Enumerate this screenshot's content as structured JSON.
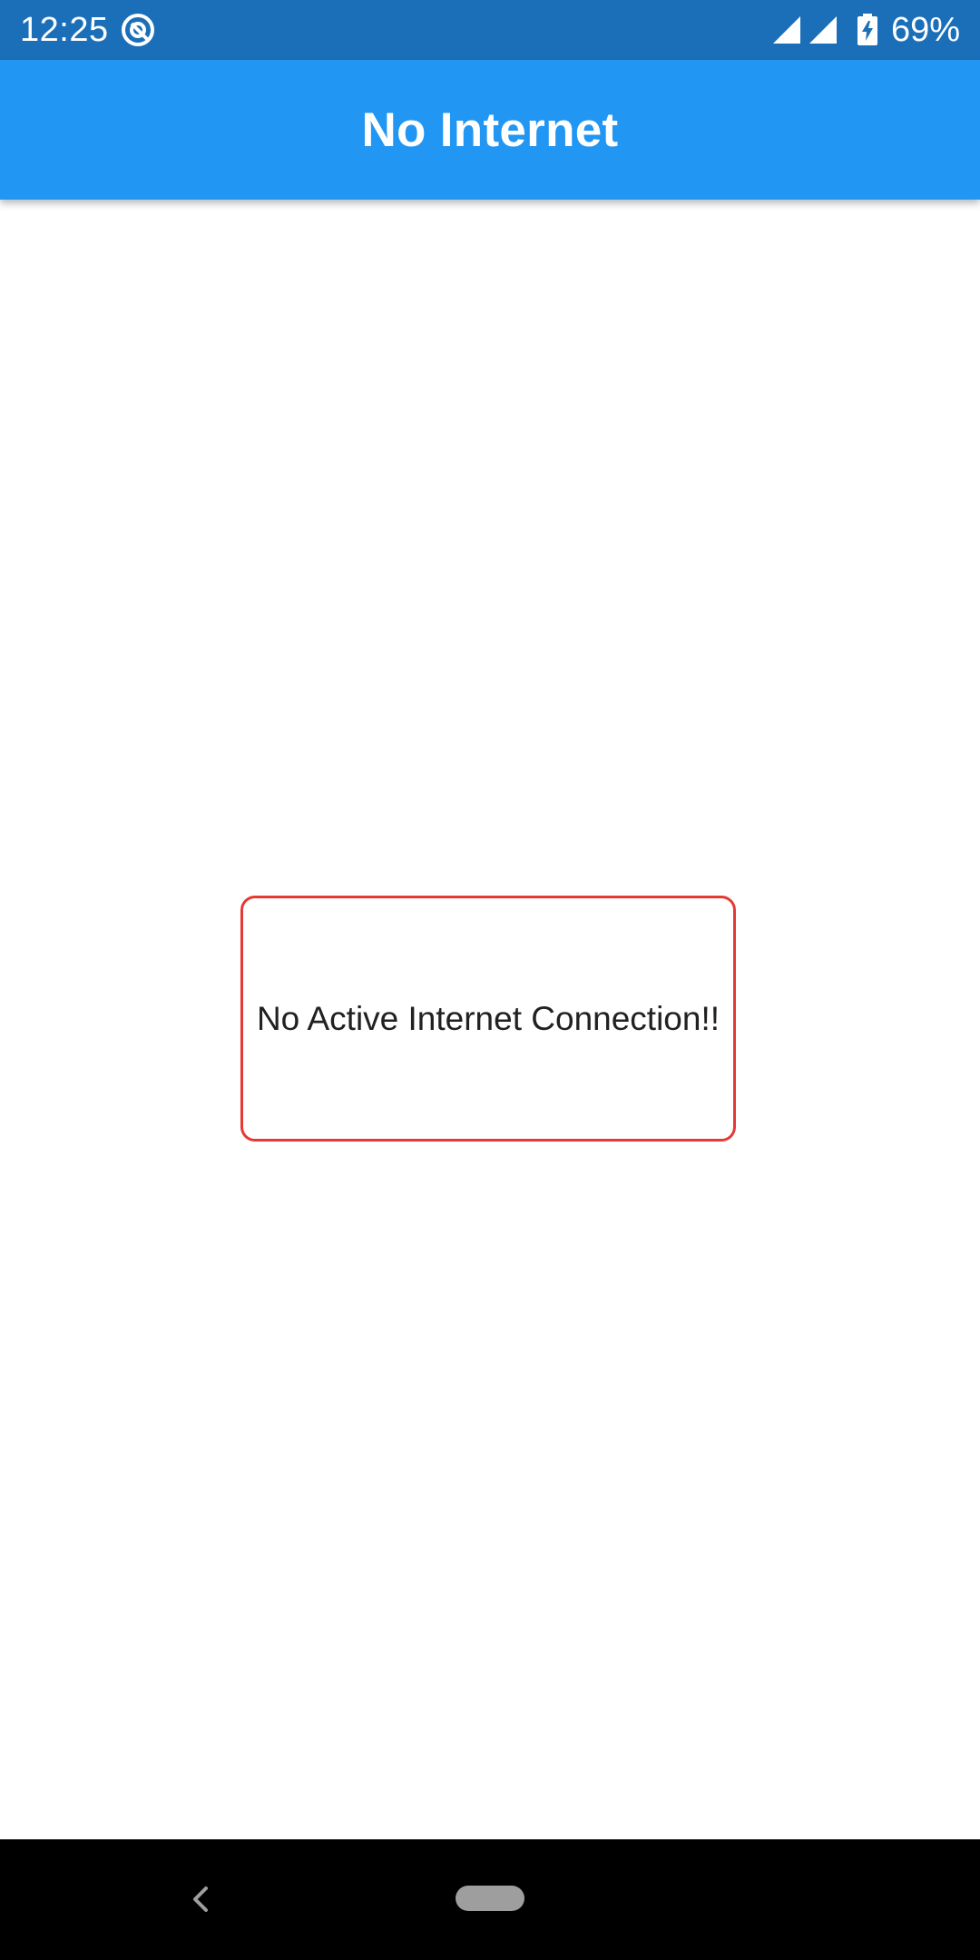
{
  "status_bar": {
    "time": "12:25",
    "battery_percent": "69%",
    "icons": [
      "app-notification-icon",
      "signal-icon",
      "signal-icon",
      "battery-charging-icon"
    ]
  },
  "app_bar": {
    "title": "No Internet",
    "color": "#2196f3"
  },
  "main": {
    "message": "No Active Internet Connection!!",
    "border_color": "#e53935"
  },
  "nav_bar": {
    "icons": [
      "back-icon",
      "home-pill-icon"
    ]
  }
}
